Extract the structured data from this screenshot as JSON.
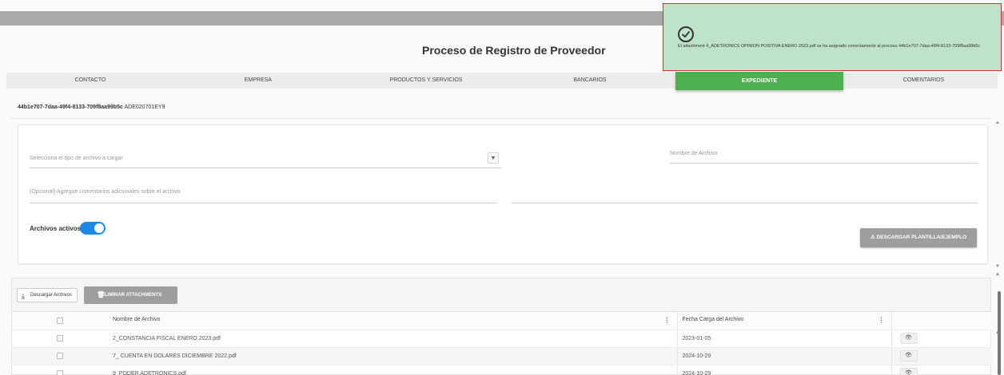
{
  "page": {
    "title": "Proceso de Registro de Proveedor",
    "record_id": "44b1e707-7daa-49f4-8133-709f8aa99b5c",
    "record_code": "ADE020701EY9"
  },
  "tabs": [
    {
      "label": "CONTACTO"
    },
    {
      "label": "EMPRESA"
    },
    {
      "label": "PRODUCTOS Y SERVICIOS"
    },
    {
      "label": "BANCARIOS"
    },
    {
      "label": "EXPEDIENTE",
      "active": true
    },
    {
      "label": "COMENTARIOS"
    }
  ],
  "form": {
    "file_type_placeholder": "Selecciona el tipo de archivo a cargar",
    "file_name_placeholder": "Nombre de Archivo",
    "comments_placeholder": "(Opcional) Agregue comentarios adicionales sobre el archivo",
    "active_files_label": "Archivos activos",
    "active_files_on": true,
    "download_template_label": "DESCARGAR PLANTILLA/EJEMPLO"
  },
  "toolbar": {
    "download_label": "Descargar Archivos",
    "delete_label": "ELIMINAR ATTACHMENTS"
  },
  "table": {
    "columns": [
      "Nombre de Archivo",
      "Fecha Carga del Archivo"
    ],
    "rows": [
      {
        "name": "2_CONSTANCIA FISCAL ENERO 2023.pdf",
        "date": "2023-01-05"
      },
      {
        "name": "7_ CUENTA EN DOLARES DICIEMBRE 2022.pdf",
        "date": "2024-10-29"
      },
      {
        "name": "9_PODER ADETRONICS.pdf",
        "date": "2024-10-29"
      }
    ]
  },
  "toast": {
    "message": "El attachment 4_ADETRONICS OPINION POSITIVA ENERO 2023.pdf se ha asignado correctamente al proceso 44b1e707-7daa-49f4-8133-709f8aa99b5c"
  },
  "colors": {
    "accent_green": "#4caf50",
    "toggle_blue": "#1e88e5",
    "toast_bg": "#bfe3c9",
    "toast_border": "#d32f2f"
  }
}
